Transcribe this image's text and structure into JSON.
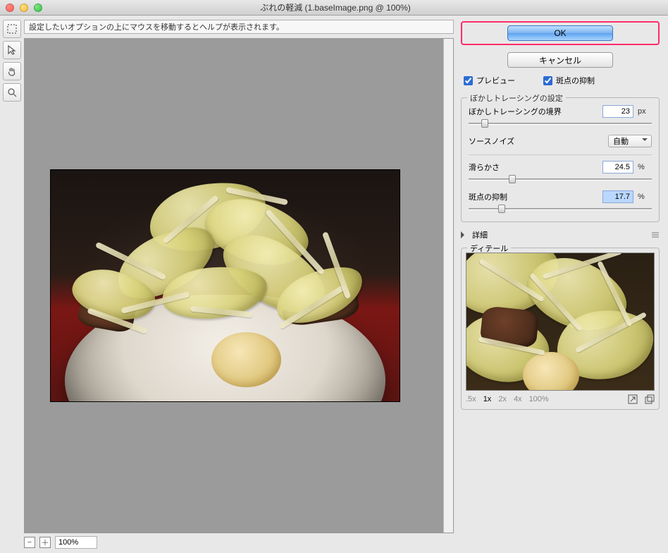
{
  "window": {
    "title": "ぶれの軽減 (1.baseImage.png @ 100%)"
  },
  "help": {
    "text": "設定したいオプションの上にマウスを移動するとヘルプが表示されます。"
  },
  "zoom": {
    "value": "100%"
  },
  "buttons": {
    "ok": "OK",
    "cancel": "キャンセル"
  },
  "checks": {
    "preview": {
      "label": "プレビュー",
      "checked": true
    },
    "artifact": {
      "label": "斑点の抑制",
      "checked": true
    }
  },
  "group": {
    "title": "ぼかしトレーシングの設定",
    "bounds": {
      "label": "ぼかしトレーシングの境界",
      "value": "23",
      "unit": "px",
      "pos": 9
    },
    "sourceNoise": {
      "label": "ソースノイズ",
      "value": "自動"
    },
    "smoothing": {
      "label": "滑らかさ",
      "value": "24.5",
      "unit": "%",
      "pos": 24
    },
    "artifact": {
      "label": "斑点の抑制",
      "value": "17.7",
      "unit": "%",
      "pos": 18
    }
  },
  "advanced": {
    "label": "詳細"
  },
  "detail": {
    "title": "ディテール",
    "zooms": {
      "x05": ".5x",
      "x1": "1x",
      "x2": "2x",
      "x4": "4x",
      "x100": "100%"
    }
  },
  "icons": {
    "marquee": "marquee-icon",
    "arrow": "arrow-icon",
    "hand": "hand-icon",
    "zoom": "zoom-icon",
    "minus": "minus-icon",
    "plus": "plus-icon",
    "dock": "dock-icon",
    "undock": "undock-icon"
  }
}
